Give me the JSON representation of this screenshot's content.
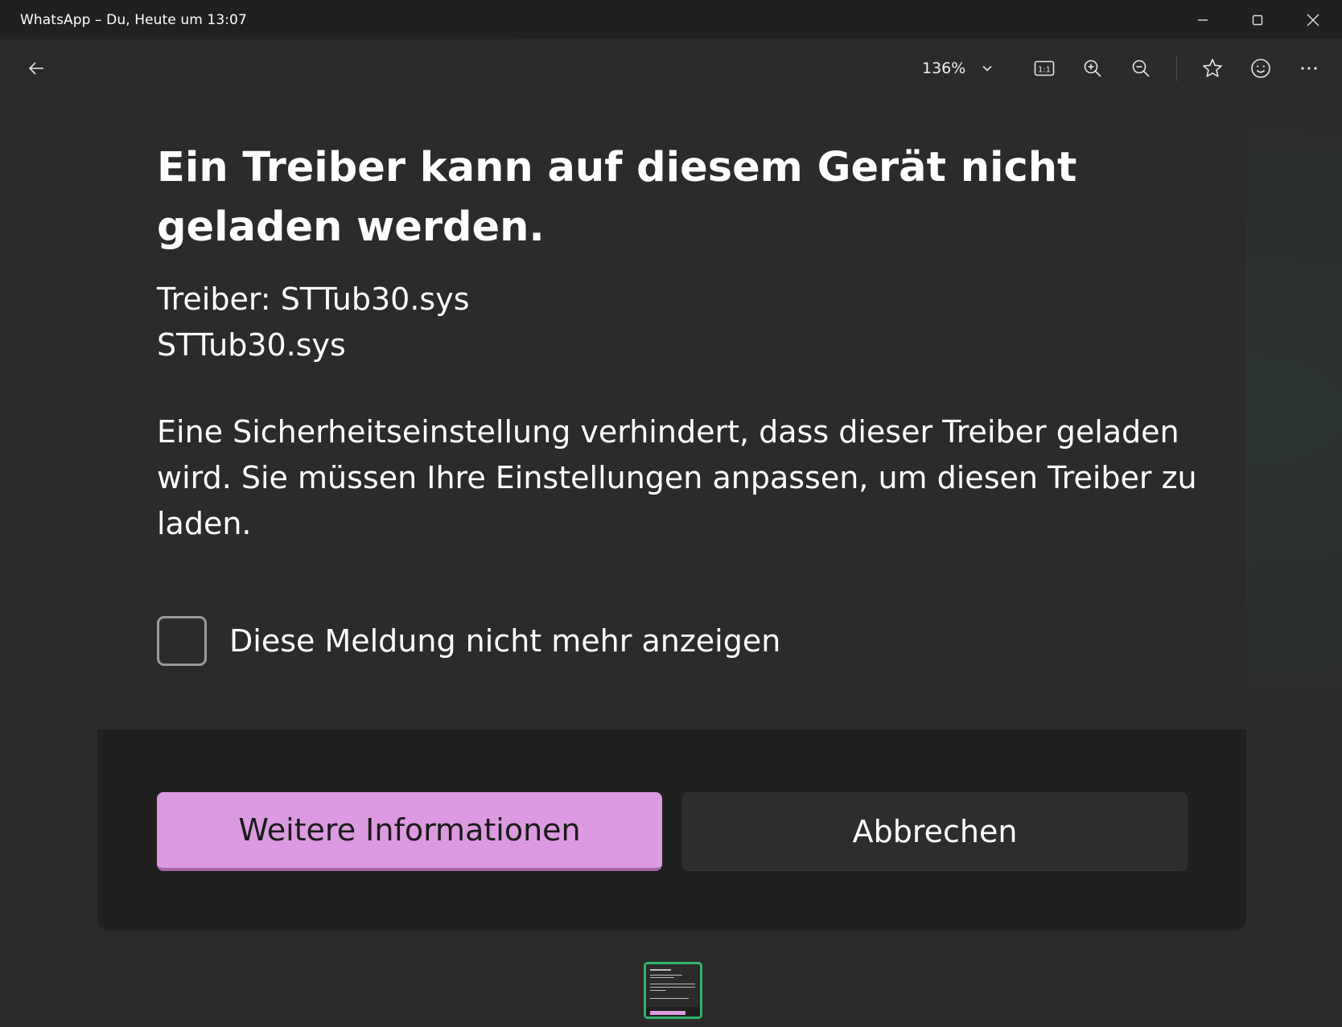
{
  "window": {
    "title": "WhatsApp – Du, Heute um 13:07",
    "minimize_icon": "minimize-icon",
    "maximize_icon": "maximize-icon",
    "close_icon": "close-icon"
  },
  "toolbar": {
    "back_icon": "back-arrow-icon",
    "zoom_level": "136%",
    "actual_size_label": "1:1",
    "icons": [
      "chevron-down-icon",
      "actual-size-icon",
      "zoom-in-icon",
      "zoom-out-icon",
      "star-icon",
      "emoji-icon",
      "more-icon"
    ]
  },
  "dialog": {
    "title": "Ein Treiber kann auf diesem Gerät nicht geladen werden.",
    "driver_label": "Treiber: STTub30.sys",
    "driver_file": "STTub30.sys",
    "message": "Eine Sicherheitseinstellung verhindert, dass dieser Treiber geladen wird. Sie müssen Ihre Einstellungen anpassen, um diesen Treiber zu laden.",
    "checkbox_label": "Diese Meldung nicht mehr anzeigen",
    "checkbox_checked": false,
    "primary_button": "Weitere Informationen",
    "secondary_button": "Abbrechen"
  },
  "colors": {
    "accent": "#dc9be0",
    "thumbnail_border": "#2fb36a",
    "titlebar_bg": "#202020",
    "footer_bg": "#202020"
  }
}
